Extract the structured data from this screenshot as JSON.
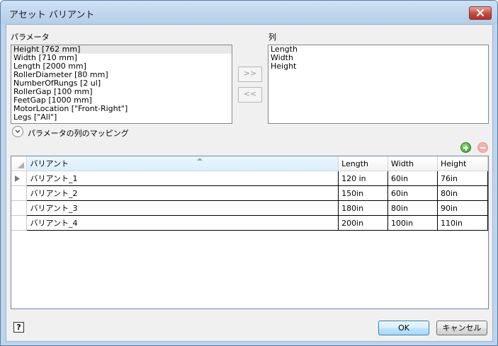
{
  "window": {
    "title": "アセット バリアント"
  },
  "parameters": {
    "label": "パラメータ",
    "items": [
      "Height [762 mm]",
      "Width [710 mm]",
      "Length [2000 mm]",
      "RollerDiameter [80 mm]",
      "NumberOfRungs [2 ul]",
      "RollerGap [100 mm]",
      "FeetGap [1000 mm]",
      "MotorLocation [\"Front-Right\"]",
      "Legs [\"All\"]"
    ]
  },
  "columns": {
    "label": "列",
    "items": [
      "Length",
      "Width",
      "Height"
    ]
  },
  "buttons": {
    "add_label": ">>",
    "remove_label": "<<",
    "ok": "OK",
    "cancel": "キャンセル",
    "help": "?"
  },
  "mapping": {
    "label": "パラメータの列のマッピング"
  },
  "grid": {
    "headers": [
      "バリアント",
      "Length",
      "Width",
      "Height"
    ],
    "rows": [
      [
        "バリアント_1",
        "120 in",
        "60in",
        "76in"
      ],
      [
        "バリアント_2",
        "150in",
        "60in",
        "80in"
      ],
      [
        "バリアント_3",
        "180in",
        "80in",
        "90in"
      ],
      [
        "バリアント_4",
        "200in",
        "100in",
        "110in"
      ]
    ]
  },
  "icons": {
    "add_row": "plus-circle-icon",
    "remove_row": "minus-circle-icon",
    "expand": "chevron-down-icon",
    "close": "close-icon"
  },
  "colors": {
    "title_bar": "#bcd4ec",
    "close_button": "#c9463a",
    "add_icon": "#2f9a20",
    "remove_icon": "#f4b0aa",
    "ok_button": "#bee6fd"
  }
}
